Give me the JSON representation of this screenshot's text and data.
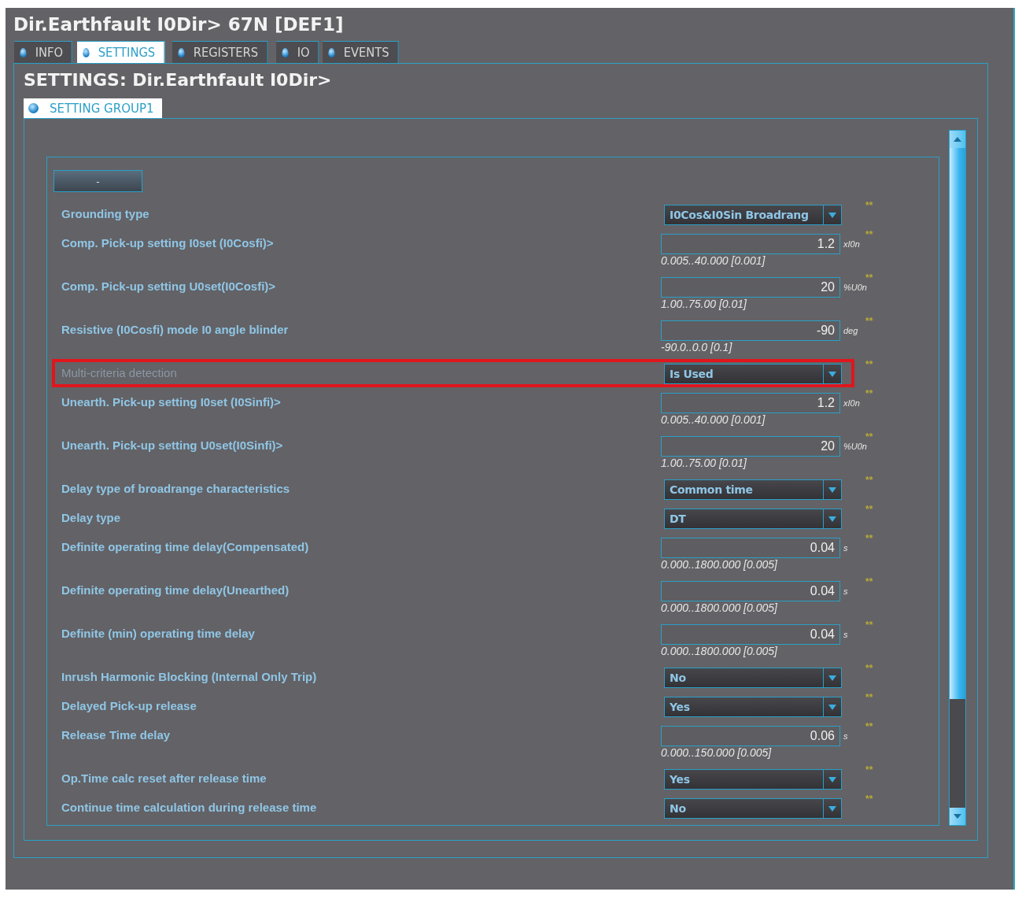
{
  "window": {
    "title": "Dir.Earthfault I0Dir> 67N [DEF1]"
  },
  "tabs": [
    {
      "label": "INFO",
      "selected": false
    },
    {
      "label": "SETTINGS",
      "selected": true
    },
    {
      "label": "REGISTERS",
      "selected": false
    },
    {
      "label": "IO",
      "selected": false
    },
    {
      "label": "EVENTS",
      "selected": false
    }
  ],
  "panel_title": "SETTINGS: Dir.Earthfault I0Dir>",
  "group_tabs": [
    {
      "label": "SETTING GROUP1",
      "selected": true
    }
  ],
  "collapse_button": "-",
  "settings": [
    {
      "kind": "dropdown",
      "label": "Grounding type",
      "value": "I0Cos&I0Sin Broadrang",
      "flag": "**",
      "disabled": false,
      "highlighted": false
    },
    {
      "kind": "number",
      "label": "Comp. Pick-up setting I0set (I0Cosfi)>",
      "value": "1.2",
      "unit": "xI0n",
      "range": "0.005..40.000 [0.001]",
      "flag": "**",
      "disabled": false,
      "highlighted": false
    },
    {
      "kind": "number",
      "label": "Comp. Pick-up setting U0set(I0Cosfi)>",
      "value": "20",
      "unit": "%U0n",
      "range": "1.00..75.00 [0.01]",
      "flag": "**",
      "disabled": false,
      "highlighted": false
    },
    {
      "kind": "number",
      "label": "Resistive (I0Cosfi) mode I0 angle blinder",
      "value": "-90",
      "unit": "deg",
      "range": "-90.0..0.0 [0.1]",
      "flag": "**",
      "disabled": false,
      "highlighted": false
    },
    {
      "kind": "dropdown",
      "label": "Multi-criteria detection",
      "value": "Is Used",
      "flag": "**",
      "disabled": true,
      "highlighted": true
    },
    {
      "kind": "number",
      "label": "Unearth. Pick-up setting I0set (I0Sinfi)>",
      "value": "1.2",
      "unit": "xI0n",
      "range": "0.005..40.000 [0.001]",
      "flag": "**",
      "disabled": false,
      "highlighted": false
    },
    {
      "kind": "number",
      "label": "Unearth. Pick-up setting U0set(I0Sinfi)>",
      "value": "20",
      "unit": "%U0n",
      "range": "1.00..75.00 [0.01]",
      "flag": "**",
      "disabled": false,
      "highlighted": false
    },
    {
      "kind": "dropdown",
      "label": "Delay type of broadrange characteristics",
      "value": "Common time",
      "flag": "**",
      "disabled": false,
      "highlighted": false
    },
    {
      "kind": "dropdown",
      "label": "Delay type",
      "value": "DT",
      "flag": "**",
      "disabled": false,
      "highlighted": false
    },
    {
      "kind": "number",
      "label": "Definite operating time delay(Compensated)",
      "value": "0.04",
      "unit": "s",
      "range": "0.000..1800.000 [0.005]",
      "flag": "**",
      "disabled": false,
      "highlighted": false
    },
    {
      "kind": "number",
      "label": "Definite operating time delay(Unearthed)",
      "value": "0.04",
      "unit": "s",
      "range": "0.000..1800.000 [0.005]",
      "flag": "**",
      "disabled": false,
      "highlighted": false
    },
    {
      "kind": "number",
      "label": "Definite (min) operating time delay",
      "value": "0.04",
      "unit": "s",
      "range": "0.000..1800.000 [0.005]",
      "flag": "**",
      "disabled": false,
      "highlighted": false
    },
    {
      "kind": "dropdown",
      "label": "Inrush Harmonic Blocking (Internal Only Trip)",
      "value": "No",
      "flag": "**",
      "disabled": false,
      "highlighted": false
    },
    {
      "kind": "dropdown",
      "label": "Delayed Pick-up release",
      "value": "Yes",
      "flag": "**",
      "disabled": false,
      "highlighted": false
    },
    {
      "kind": "number",
      "label": "Release Time delay",
      "value": "0.06",
      "unit": "s",
      "range": "0.000..150.000 [0.005]",
      "flag": "**",
      "disabled": false,
      "highlighted": false
    },
    {
      "kind": "dropdown",
      "label": "Op.Time calc reset after release time",
      "value": "Yes",
      "flag": "**",
      "disabled": false,
      "highlighted": false
    },
    {
      "kind": "dropdown",
      "label": "Continue time calculation during release time",
      "value": "No",
      "flag": "**",
      "disabled": false,
      "highlighted": false
    }
  ]
}
